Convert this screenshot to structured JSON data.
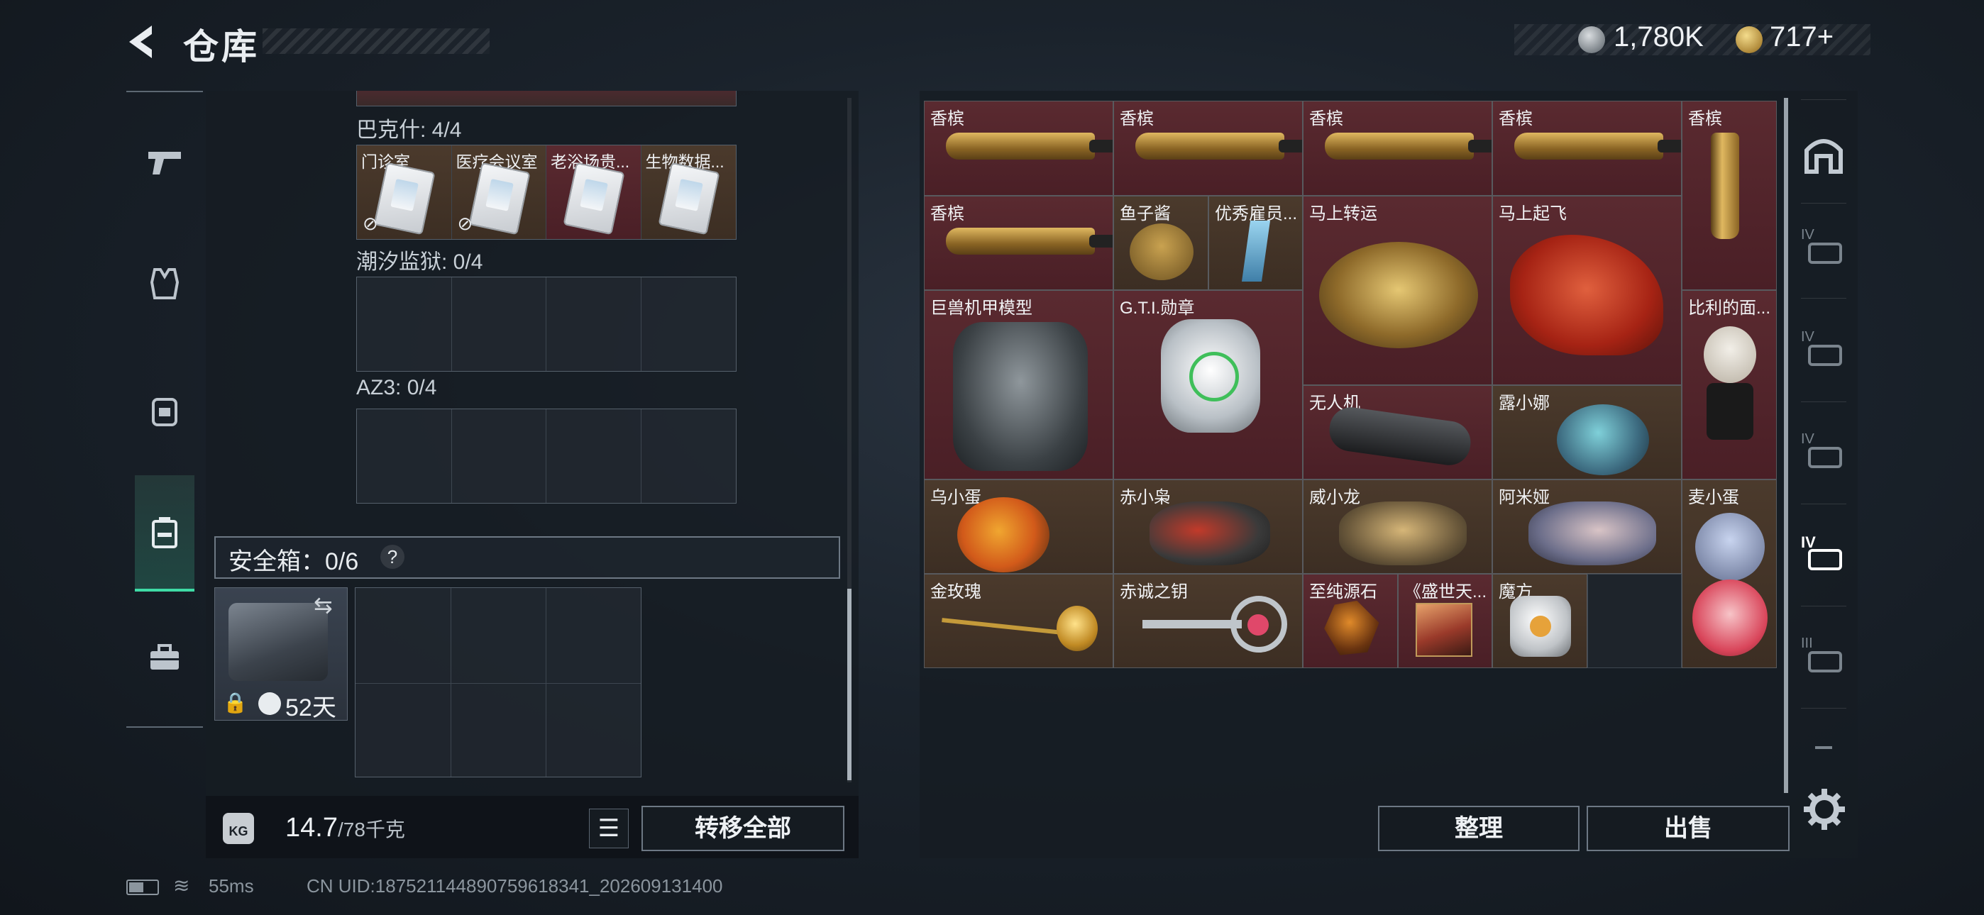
{
  "header": {
    "title": "仓库",
    "currency_silver": "1,780K",
    "currency_gold": "717+"
  },
  "left_nav": {
    "items": [
      {
        "icon": "gun-icon"
      },
      {
        "icon": "vest-icon"
      },
      {
        "icon": "backpack-icon"
      },
      {
        "icon": "case-icon",
        "active": true
      },
      {
        "icon": "toolbox-icon"
      }
    ]
  },
  "left": {
    "sections": [
      {
        "label": "巴克什: 4/4",
        "slots": [
          "门诊室",
          "医疗会议室",
          "老浴场贵...",
          "生物数据..."
        ]
      },
      {
        "label": "潮汐监狱: 0/4"
      },
      {
        "label": "AZ3: 0/4"
      }
    ],
    "safe_box_label": "安全箱：0/6",
    "help": "?",
    "case_timer": "52天",
    "weight_current": "14.7",
    "weight_max": "/78千克",
    "weight_icon_text": "KG",
    "transfer_all": "转移全部"
  },
  "right": {
    "items": [
      {
        "name": "香槟"
      },
      {
        "name": "香槟"
      },
      {
        "name": "香槟"
      },
      {
        "name": "香槟"
      },
      {
        "name": "香槟"
      },
      {
        "name": "香槟"
      },
      {
        "name": "鱼子酱"
      },
      {
        "name": "优秀雇员..."
      },
      {
        "name": "马上转运"
      },
      {
        "name": "马上起飞"
      },
      {
        "name": "巨兽机甲模型"
      },
      {
        "name": "G.T.I.勋章"
      },
      {
        "name": "比利的面..."
      },
      {
        "name": "无人机"
      },
      {
        "name": "露小娜"
      },
      {
        "name": "乌小蛋"
      },
      {
        "name": "赤小枭"
      },
      {
        "name": "威小龙"
      },
      {
        "name": "阿米娅"
      },
      {
        "name": "麦小蛋"
      },
      {
        "name": "金玫瑰"
      },
      {
        "name": "赤诚之钥"
      },
      {
        "name": "至纯源石"
      },
      {
        "name": "《盛世天..."
      },
      {
        "name": "魔方"
      }
    ],
    "tidy": "整理",
    "sell": "出售"
  },
  "right_nav": {
    "items": [
      "base-icon",
      "tier-iv-case-icon",
      "tier-iv-case-icon",
      "tier-iv-case-icon",
      "tier-iv-case-icon-active",
      "tier-iii-case-icon"
    ],
    "tier_labels": [
      "IV",
      "IV",
      "IV",
      "IV",
      "III"
    ]
  },
  "status": {
    "ping": "55ms",
    "uid": "CN UID:18752114489075961834​1_202609131400"
  },
  "colors": {
    "accent": "#3fdba6",
    "red_rarity": "#5a2a30",
    "gold_rarity": "#4b3a2c"
  }
}
